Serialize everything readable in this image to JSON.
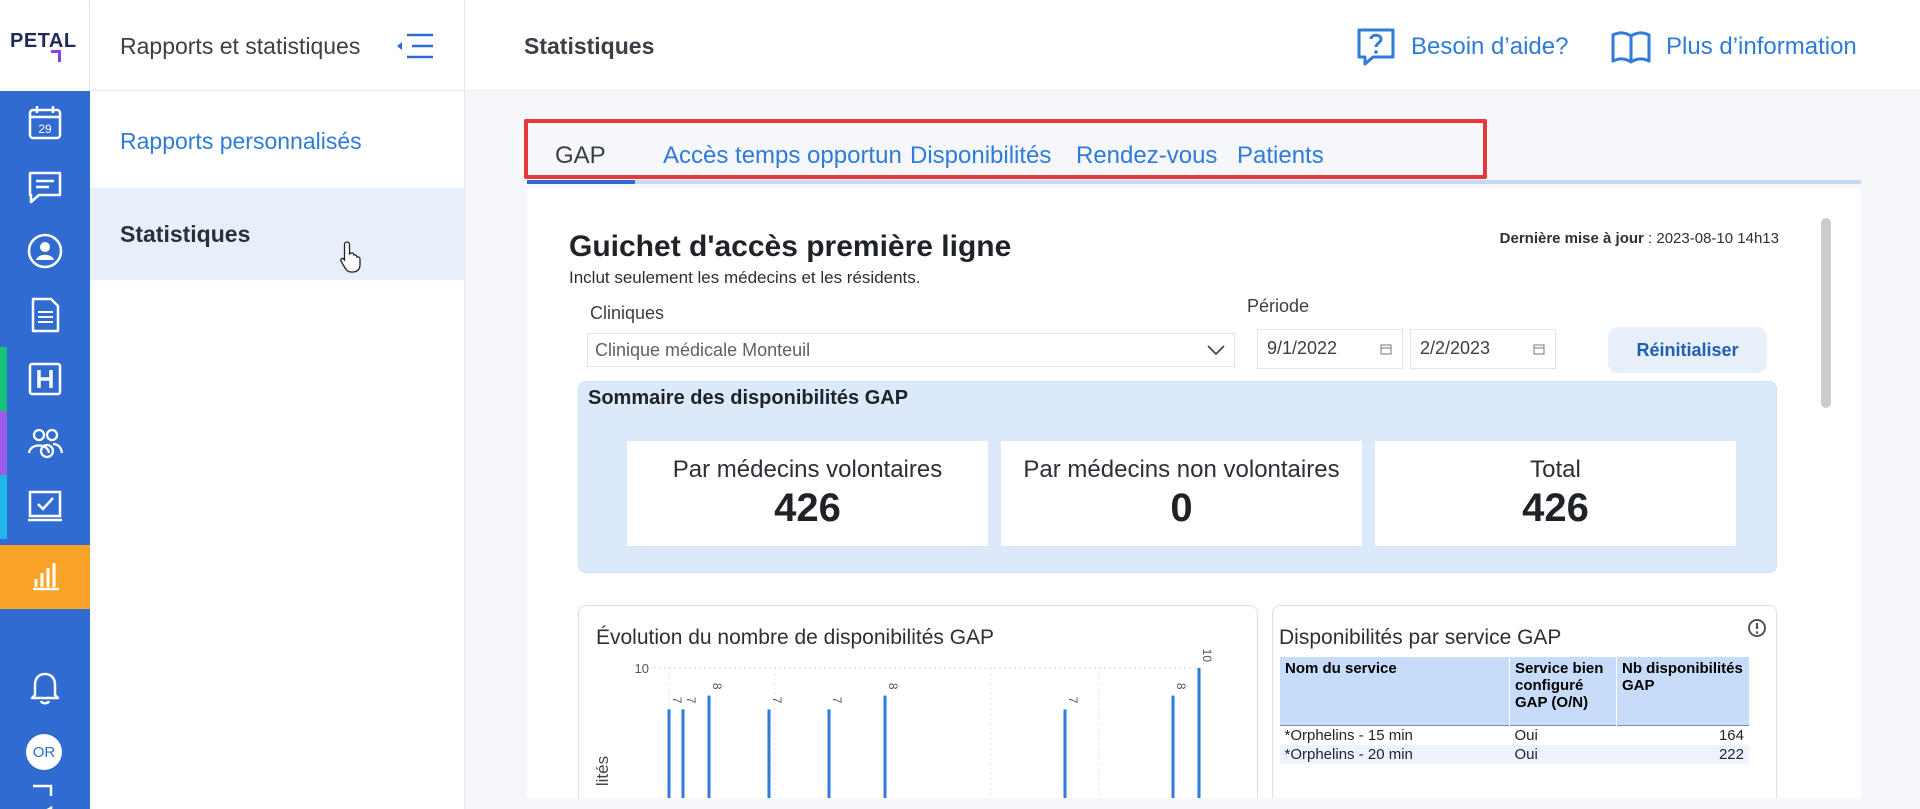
{
  "brand": {
    "logo_text": "PETAL"
  },
  "rail": {
    "calendar_day": "29",
    "avatar_initials": "OR",
    "active_color": "#f8a325",
    "rail_color": "#2f6bd0"
  },
  "sidebar": {
    "title": "Rapports et statistiques",
    "items": [
      {
        "label": "Rapports personnalisés"
      },
      {
        "label": "Statistiques"
      }
    ]
  },
  "header": {
    "page_title": "Statistiques",
    "help_label": "Besoin d’aide?",
    "info_label": "Plus d’information"
  },
  "tabs": [
    {
      "label": "GAP"
    },
    {
      "label": "Accès temps opportun"
    },
    {
      "label": "Disponibilités"
    },
    {
      "label": "Rendez-vous"
    },
    {
      "label": "Patients"
    }
  ],
  "report": {
    "title": "Guichet d'accès première ligne",
    "subtitle": "Inclut seulement les médecins et les résidents.",
    "updated_label": "Dernière mise à jour",
    "updated_value": " : 2023-08-10 14h13",
    "clinics_label": "Cliniques",
    "clinic_value": "Clinique médicale Monteuil",
    "period_label": "Période",
    "date_from": "9/1/2022",
    "date_to": "2/2/2023",
    "reset_label": "Réinitialiser"
  },
  "summary": {
    "title": "Sommaire des disponibilités GAP",
    "kpis": [
      {
        "label": "Par médecins volontaires",
        "value": "426"
      },
      {
        "label": "Par médecins non volontaires",
        "value": "0"
      },
      {
        "label": "Total",
        "value": "426"
      }
    ]
  },
  "chart_data": {
    "type": "bar",
    "title": "Évolution du nombre de disponibilités GAP",
    "ylabel": "lités",
    "y_ticks": [
      "10"
    ],
    "values": [
      7,
      7,
      8,
      7,
      7,
      8,
      7,
      8,
      10
    ],
    "data_labels": [
      "7",
      "7",
      "8",
      "7",
      "7",
      "8",
      "7",
      "8",
      "10"
    ],
    "color": "#2f7bd9"
  },
  "services_table": {
    "title": "Disponibilités par service GAP",
    "columns": [
      "Nom du service",
      "Service bien configuré GAP (O/N)",
      "Nb disponibilités GAP"
    ],
    "rows": [
      [
        "*Orphelins - 15 min",
        "Oui",
        "164"
      ],
      [
        "*Orphelins - 20 min",
        "Oui",
        "222"
      ]
    ]
  }
}
